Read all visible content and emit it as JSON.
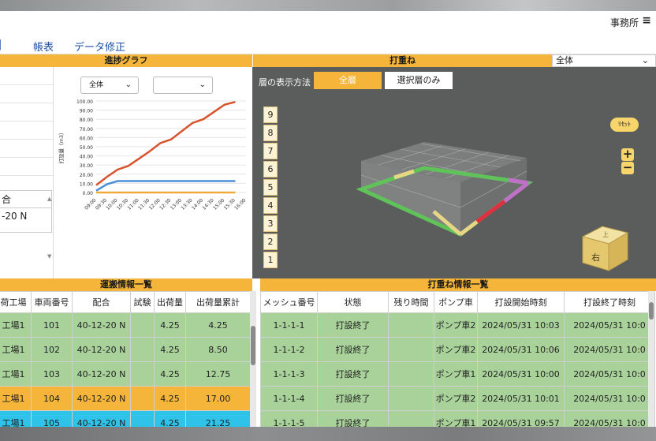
{
  "header": {
    "office_label": "事務所",
    "menu_icon": "hamburger-icon"
  },
  "tabs": [
    "帳表",
    "データ修正"
  ],
  "panels": {
    "progress": "進捗グラフ",
    "placement": "打重ね"
  },
  "placement_filter": {
    "selected": "全体"
  },
  "left_list": {
    "header_fragment": "合",
    "value_fragment": "-20 N"
  },
  "chart_controls": {
    "filter1": "全体",
    "filter2": ""
  },
  "view3d": {
    "display_method_label": "層の表示方法",
    "btn_all": "全層",
    "btn_selected": "選択層のみ",
    "layers": [
      "9",
      "8",
      "7",
      "6",
      "5",
      "4",
      "3",
      "2",
      "1"
    ],
    "reset_label": "ﾘｾｯﾄ",
    "zoom_in": "+",
    "zoom_out": "−",
    "cube_labels": {
      "front": "右",
      "top": "上"
    }
  },
  "chart_data": {
    "type": "line",
    "ylabel": "打設量（m3）",
    "ylim": [
      0,
      100
    ],
    "yticks": [
      "100.00",
      "90.00",
      "80.00",
      "70.00",
      "60.00",
      "50.00",
      "40.00",
      "30.00",
      "20.00",
      "10.00",
      "0.00"
    ],
    "x": [
      "09:00",
      "09:30",
      "10:00",
      "10:30",
      "11:00",
      "11:30",
      "12:00",
      "12:30",
      "13:00",
      "13:30",
      "14:00",
      "14:30",
      "15:00",
      "15:30",
      "16:00"
    ],
    "series": [
      {
        "color": "#d9532d",
        "values": [
          8,
          17,
          25,
          29,
          37,
          45,
          54,
          58,
          67,
          76,
          80,
          88,
          96,
          99
        ]
      },
      {
        "color": "#4a90d9",
        "values": [
          2,
          9,
          12.5,
          12.5,
          12.5,
          12.5,
          12.5,
          12.5,
          12.5,
          12.5,
          12.5,
          12.5,
          12.5,
          12.5
        ]
      },
      {
        "color": "#f2a93b",
        "values": [
          0,
          0,
          0,
          0,
          0,
          0,
          0,
          0,
          0,
          0,
          0,
          0,
          0,
          0
        ]
      }
    ]
  },
  "transport": {
    "title": "運搬情報一覧",
    "columns": [
      "荷工場",
      "車両番号",
      "配合",
      "試験",
      "出荷量",
      "出荷量累計"
    ],
    "rows": [
      {
        "status": "green",
        "cells": [
          "工場1",
          "101",
          "40-12-20 N",
          "",
          "4.25",
          "4.25"
        ]
      },
      {
        "status": "green",
        "cells": [
          "工場1",
          "102",
          "40-12-20 N",
          "",
          "4.25",
          "8.50"
        ]
      },
      {
        "status": "green",
        "cells": [
          "工場1",
          "103",
          "40-12-20 N",
          "",
          "4.25",
          "12.75"
        ]
      },
      {
        "status": "orange",
        "cells": [
          "工場1",
          "104",
          "40-12-20 N",
          "",
          "4.25",
          "17.00"
        ]
      },
      {
        "status": "cyan",
        "cells": [
          "工場1",
          "105",
          "40-12-20 N",
          "",
          "4.25",
          "21.25"
        ]
      }
    ]
  },
  "placement_list": {
    "title": "打重ね情報一覧",
    "columns": [
      "メッシュ番号",
      "状態",
      "残り時間",
      "ポンプ車",
      "打設開始時刻",
      "打設終了時刻"
    ],
    "rows": [
      {
        "status": "green",
        "cells": [
          "1-1-1-1",
          "打設終了",
          "",
          "ポンプ車2",
          "2024/05/31 10:03",
          "2024/05/31 10:0"
        ]
      },
      {
        "status": "green",
        "cells": [
          "1-1-1-2",
          "打設終了",
          "",
          "ポンプ車2",
          "2024/05/31 10:06",
          "2024/05/31 10:0"
        ]
      },
      {
        "status": "green",
        "cells": [
          "1-1-1-3",
          "打設終了",
          "",
          "ポンプ車1",
          "2024/05/31 10:00",
          "2024/05/31 10:0"
        ]
      },
      {
        "status": "green",
        "cells": [
          "1-1-1-4",
          "打設終了",
          "",
          "ポンプ車2",
          "2024/05/31 10:01",
          "2024/05/31 10:0"
        ]
      },
      {
        "status": "green",
        "cells": [
          "1-1-1-5",
          "打設終了",
          "",
          "ポンプ車1",
          "2024/05/31 09:57",
          "2024/05/31 10:0"
        ]
      }
    ]
  }
}
